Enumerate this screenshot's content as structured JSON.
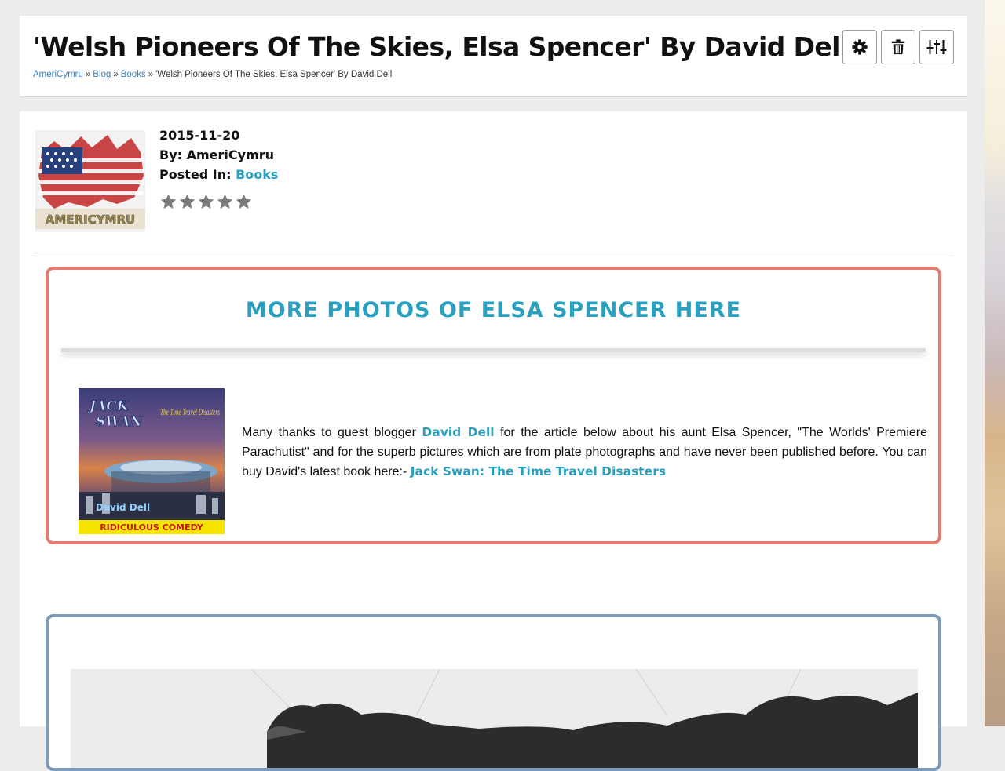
{
  "page": {
    "title": "'Welsh Pioneers Of The Skies, Elsa Spencer' By David Dell",
    "breadcrumb": [
      {
        "label": "AmeriCymru",
        "link": true
      },
      {
        "label": "Blog",
        "link": true
      },
      {
        "label": "Books",
        "link": true
      },
      {
        "label": "'Welsh Pioneers Of The Skies, Elsa Spencer' By David Dell",
        "link": false
      }
    ],
    "breadcrumb_separator": "»",
    "toolbar": {
      "buttons": [
        {
          "icon": "gear-icon"
        },
        {
          "icon": "trash-icon"
        },
        {
          "icon": "sliders-icon"
        }
      ]
    }
  },
  "post": {
    "avatar_text": "AMERICYMRU",
    "date": "2015-11-20",
    "by_label": "By:",
    "author": "AmeriCymru",
    "posted_in_label": "Posted In:",
    "category": "Books",
    "rating": {
      "value": 0,
      "max": 5
    }
  },
  "promo": {
    "heading": "MORE PHOTOS OF ELSA SPENCER HERE",
    "book_cover": {
      "title_line1": "JACK",
      "title_line2": "SWAN",
      "subtitle": "The Time Travel Disasters",
      "author": "David Dell",
      "banner": "RIDICULOUS COMEDY"
    },
    "text_before_link": "Many thanks to guest blogger",
    "author_link": "David Dell",
    "text_middle": "for the article below about his aunt Elsa Spencer, \"The Worlds' Premiere Parachutist\" and for the superb pictures which are from plate photographs and have never been published before. You can buy David's latest book here:-",
    "book_link": "Jack Swan: The Time Travel Disasters"
  },
  "colors": {
    "link": "#2aa0c0",
    "breadcrumb_link": "#3f7fb6",
    "promo_border": "#e27d6f",
    "photo_border": "#7e9bb9",
    "star": "#7a7a7a"
  }
}
